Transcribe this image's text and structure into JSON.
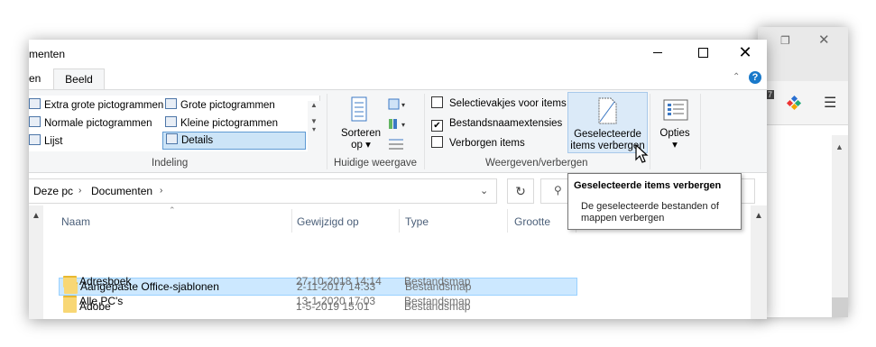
{
  "window": {
    "title": "menten",
    "tabs": {
      "previous_tab": "en",
      "active_tab": "Beeld"
    }
  },
  "ribbon": {
    "layout": {
      "items": [
        "Extra grote pictogrammen",
        "Grote pictogrammen",
        "Normale pictogrammen",
        "Kleine pictogrammen",
        "Lijst",
        "Details"
      ],
      "selected": "Details",
      "group_label": "Indeling"
    },
    "current_view": {
      "sort_label_line1": "Sorteren",
      "sort_label_line2": "op",
      "group_label": "Huidige weergave"
    },
    "show_hide": {
      "checkboxes": [
        {
          "label": "Selectievakjes voor items",
          "checked": false
        },
        {
          "label": "Bestandsnaamextensies",
          "checked": true
        },
        {
          "label": "Verborgen items",
          "checked": false
        }
      ],
      "hide_button_line1": "Geselecteerde",
      "hide_button_line2": "items verbergen",
      "group_label": "Weergeven/verbergen"
    },
    "options_label": "Opties"
  },
  "address": {
    "crumbs": [
      "Deze pc",
      "Documenten"
    ],
    "refresh_icon": "refresh-icon",
    "search_icon": "search-icon"
  },
  "columns": [
    "Naam",
    "Gewijzigd op",
    "Type",
    "Grootte"
  ],
  "files": [
    {
      "name": "Aangepaste Office-sjablonen",
      "date": "2-11-2017 14:33",
      "type": "Bestandsmap",
      "selected": true
    },
    {
      "name": "Adobe",
      "date": "1-5-2019 15:01",
      "type": "Bestandsmap",
      "selected": false
    },
    {
      "name": "Adresboek",
      "date": "27-10-2018 14:14",
      "type": "Bestandsmap",
      "selected": false
    },
    {
      "name": "Alle PC's",
      "date": "13-1-2020 17:03",
      "type": "Bestandsmap",
      "selected": false
    }
  ],
  "tooltip": {
    "title": "Geselecteerde items verbergen",
    "body": "De geselecteerde bestanden of mappen verbergen"
  },
  "background_app": {
    "badge": "7"
  },
  "colors": {
    "accent": "#1979ca",
    "selection": "#cce8ff",
    "folder": "#f8d775"
  }
}
